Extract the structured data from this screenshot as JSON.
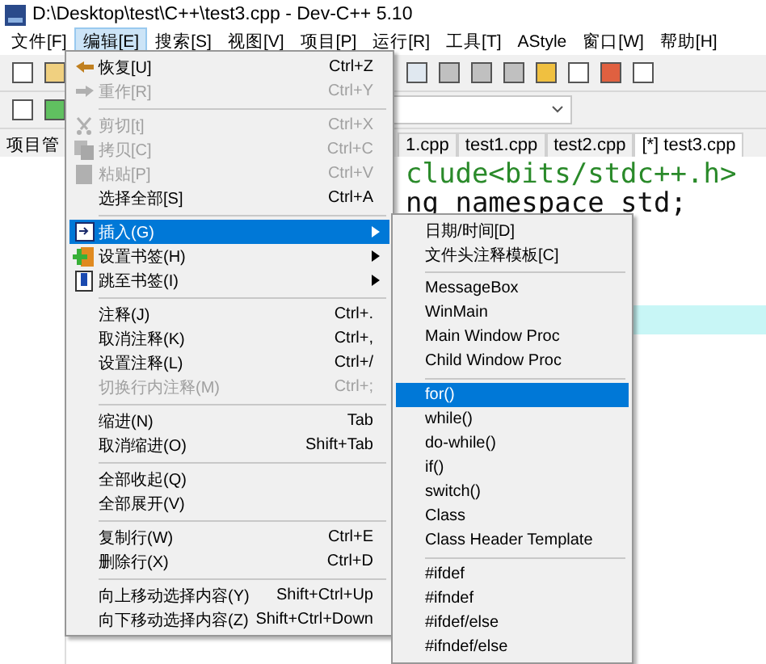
{
  "window": {
    "title": "D:\\Desktop\\test\\C++\\test3.cpp - Dev-C++ 5.10"
  },
  "menubar": [
    {
      "label": "文件[F]",
      "selected": false
    },
    {
      "label": "编辑[E]",
      "selected": true
    },
    {
      "label": "搜索[S]",
      "selected": false
    },
    {
      "label": "视图[V]",
      "selected": false
    },
    {
      "label": "项目[P]",
      "selected": false
    },
    {
      "label": "运行[R]",
      "selected": false
    },
    {
      "label": "工具[T]",
      "selected": false
    },
    {
      "label": "AStyle",
      "selected": false
    },
    {
      "label": "窗口[W]",
      "selected": false
    },
    {
      "label": "帮助[H]",
      "selected": false
    }
  ],
  "left_panel": {
    "tab": "项目管"
  },
  "tabs": [
    {
      "label": "1.cpp",
      "selected": false
    },
    {
      "label": "test1.cpp",
      "selected": false
    },
    {
      "label": "test2.cpp",
      "selected": false
    },
    {
      "label": "[*] test3.cpp",
      "selected": true
    }
  ],
  "editor": {
    "lines": [
      {
        "text": "clude<bits/stdc++.h>",
        "highlighted": false
      },
      {
        "text": "ng namespace std;",
        "highlighted": false
      },
      {
        "highlighted": false
      },
      {
        "highlighted": false
      },
      {
        "highlighted": false
      },
      {
        "highlighted": true
      }
    ]
  },
  "edit_menu": [
    {
      "kind": "item",
      "label": "恢复[U]",
      "shortcut": "Ctrl+Z",
      "disabled": false,
      "selected": false,
      "submenu": false
    },
    {
      "kind": "item",
      "label": "重作[R]",
      "shortcut": "Ctrl+Y",
      "disabled": true,
      "selected": false,
      "submenu": false
    },
    {
      "kind": "separator"
    },
    {
      "kind": "item",
      "label": "剪切[t]",
      "shortcut": "Ctrl+X",
      "disabled": true,
      "selected": false,
      "submenu": false
    },
    {
      "kind": "item",
      "label": "拷贝[C]",
      "shortcut": "Ctrl+C",
      "disabled": true,
      "selected": false,
      "submenu": false
    },
    {
      "kind": "item",
      "label": "粘贴[P]",
      "shortcut": "Ctrl+V",
      "disabled": true,
      "selected": false,
      "submenu": false
    },
    {
      "kind": "item",
      "label": "选择全部[S]",
      "shortcut": "Ctrl+A",
      "disabled": false,
      "selected": false,
      "submenu": false
    },
    {
      "kind": "separator"
    },
    {
      "kind": "item",
      "label": "插入(G)",
      "disabled": false,
      "selected": true,
      "submenu": true
    },
    {
      "kind": "item",
      "label": "设置书签(H)",
      "disabled": false,
      "selected": false,
      "submenu": true
    },
    {
      "kind": "item",
      "label": "跳至书签(I)",
      "disabled": false,
      "selected": false,
      "submenu": true
    },
    {
      "kind": "separator"
    },
    {
      "kind": "item",
      "label": "注释(J)",
      "shortcut": "Ctrl+.",
      "disabled": false,
      "selected": false,
      "submenu": false
    },
    {
      "kind": "item",
      "label": "取消注释(K)",
      "shortcut": "Ctrl+,",
      "disabled": false,
      "selected": false,
      "submenu": false
    },
    {
      "kind": "item",
      "label": "设置注释(L)",
      "shortcut": "Ctrl+/",
      "disabled": false,
      "selected": false,
      "submenu": false
    },
    {
      "kind": "item",
      "label": "切换行内注释(M)",
      "shortcut": "Ctrl+;",
      "disabled": true,
      "selected": false,
      "submenu": false
    },
    {
      "kind": "separator"
    },
    {
      "kind": "item",
      "label": "缩进(N)",
      "shortcut": "Tab",
      "disabled": false,
      "selected": false,
      "submenu": false
    },
    {
      "kind": "item",
      "label": "取消缩进(O)",
      "shortcut": "Shift+Tab",
      "disabled": false,
      "selected": false,
      "submenu": false
    },
    {
      "kind": "separator"
    },
    {
      "kind": "item",
      "label": "全部收起(Q)",
      "disabled": false,
      "selected": false,
      "submenu": false
    },
    {
      "kind": "item",
      "label": "全部展开(V)",
      "disabled": false,
      "selected": false,
      "submenu": false
    },
    {
      "kind": "separator"
    },
    {
      "kind": "item",
      "label": "复制行(W)",
      "shortcut": "Ctrl+E",
      "disabled": false,
      "selected": false,
      "submenu": false
    },
    {
      "kind": "item",
      "label": "删除行(X)",
      "shortcut": "Ctrl+D",
      "disabled": false,
      "selected": false,
      "submenu": false
    },
    {
      "kind": "separator"
    },
    {
      "kind": "item",
      "label": "向上移动选择内容(Y)",
      "shortcut": "Shift+Ctrl+Up",
      "disabled": false,
      "selected": false,
      "submenu": false
    },
    {
      "kind": "item",
      "label": "向下移动选择内容(Z)",
      "shortcut": "Shift+Ctrl+Down",
      "disabled": false,
      "selected": false,
      "submenu": false
    }
  ],
  "insert_submenu": [
    {
      "kind": "item",
      "label": "日期/时间[D]",
      "selected": false
    },
    {
      "kind": "item",
      "label": "文件头注释模板[C]",
      "selected": false
    },
    {
      "kind": "separator"
    },
    {
      "kind": "item",
      "label": "MessageBox",
      "selected": false
    },
    {
      "kind": "item",
      "label": "WinMain",
      "selected": false
    },
    {
      "kind": "item",
      "label": "Main Window Proc",
      "selected": false
    },
    {
      "kind": "item",
      "label": "Child Window Proc",
      "selected": false
    },
    {
      "kind": "separator"
    },
    {
      "kind": "item",
      "label": "for()",
      "selected": true
    },
    {
      "kind": "item",
      "label": "while()",
      "selected": false
    },
    {
      "kind": "item",
      "label": "do-while()",
      "selected": false
    },
    {
      "kind": "item",
      "label": "if()",
      "selected": false
    },
    {
      "kind": "item",
      "label": "switch()",
      "selected": false
    },
    {
      "kind": "item",
      "label": "Class",
      "selected": false
    },
    {
      "kind": "item",
      "label": "Class Header Template",
      "selected": false
    },
    {
      "kind": "separator"
    },
    {
      "kind": "item",
      "label": "#ifdef",
      "selected": false
    },
    {
      "kind": "item",
      "label": "#ifndef",
      "selected": false
    },
    {
      "kind": "item",
      "label": "#ifdef/else",
      "selected": false
    },
    {
      "kind": "item",
      "label": "#ifndef/else",
      "selected": false
    }
  ]
}
